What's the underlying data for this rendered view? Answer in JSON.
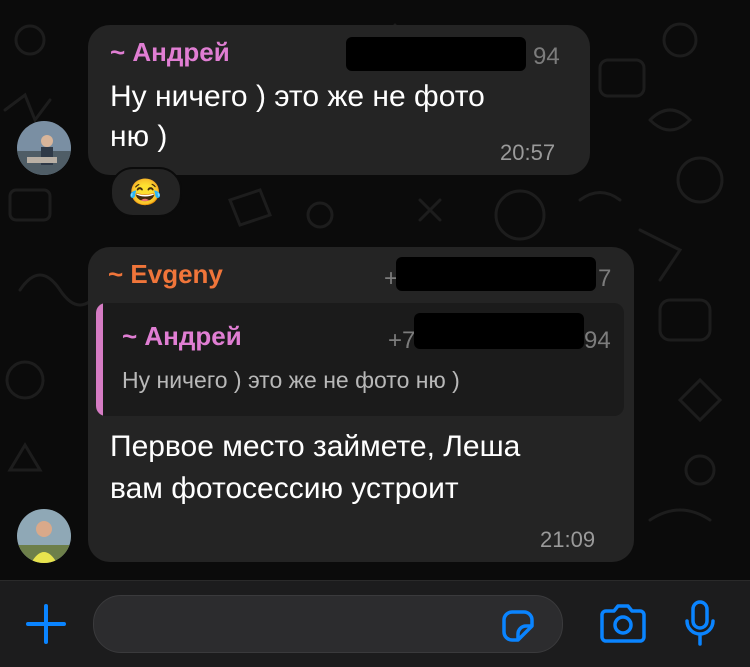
{
  "colors": {
    "accent": "#0a84ff",
    "sender1": "#e07ed3",
    "sender2": "#f0753a",
    "quote_bar": "#d67cc4"
  },
  "messages": [
    {
      "sender": "~ Андрей",
      "phone_suffix": "94",
      "text_line1": "Ну ничего ) это же не фото",
      "text_line2": "ню )",
      "time": "20:57",
      "reaction": "😂"
    },
    {
      "sender": "~ Evgeny",
      "phone_prefix": "+",
      "phone_suffix": "7",
      "quote": {
        "sender": "~ Андрей",
        "phone_prefix": "+7",
        "phone_suffix": "94",
        "text": "Ну ничего ) это же не фото ню )"
      },
      "text_line1": "Первое место займете, Леша",
      "text_line2": "вам фотосессию устроит",
      "time": "21:09"
    }
  ],
  "composer": {
    "add_icon": "plus-icon",
    "sticker_icon": "sticker-icon",
    "camera_icon": "camera-icon",
    "mic_icon": "microphone-icon"
  }
}
